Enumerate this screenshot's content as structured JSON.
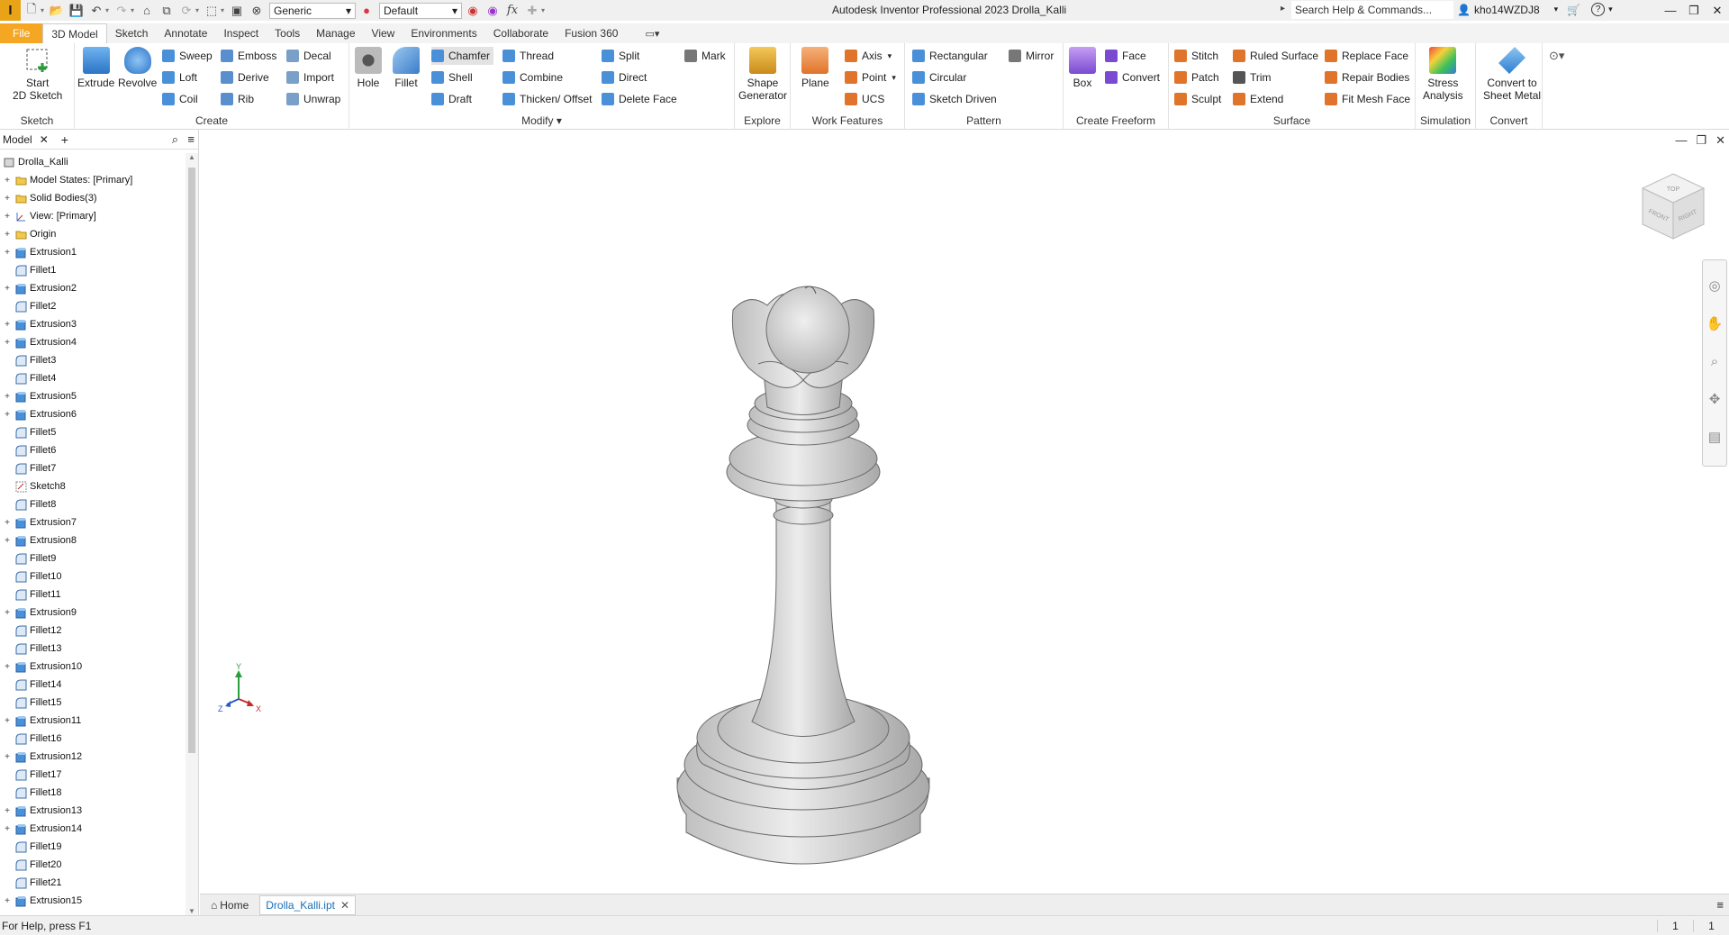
{
  "titlebar": {
    "app_logo": "I",
    "appearance_value": "Generic",
    "material_value": "Default",
    "title": "Autodesk Inventor Professional 2023   Drolla_Kalli",
    "search_placeholder": "Search Help & Commands...",
    "user_name": "kho14WZDJ8"
  },
  "tabs": [
    "File",
    "3D Model",
    "Sketch",
    "Annotate",
    "Inspect",
    "Tools",
    "Manage",
    "View",
    "Environments",
    "Collaborate",
    "Fusion 360"
  ],
  "active_tab": "3D Model",
  "ribbon": {
    "sketch": {
      "label": "Sketch",
      "start_sketch": "Start\n2D Sketch"
    },
    "create": {
      "label": "Create",
      "extrude": "Extrude",
      "revolve": "Revolve",
      "sweep": "Sweep",
      "loft": "Loft",
      "coil": "Coil",
      "emboss": "Emboss",
      "derive": "Derive",
      "rib": "Rib",
      "decal": "Decal",
      "import": "Import",
      "unwrap": "Unwrap"
    },
    "modify": {
      "label": "Modify",
      "hole": "Hole",
      "fillet": "Fillet",
      "chamfer": "Chamfer",
      "shell": "Shell",
      "draft": "Draft",
      "thread": "Thread",
      "combine": "Combine",
      "thicken": "Thicken/ Offset",
      "split": "Split",
      "direct": "Direct",
      "delete_face": "Delete Face",
      "mark": "Mark"
    },
    "explore": {
      "label": "Explore",
      "shape_generator": "Shape\nGenerator"
    },
    "work_features": {
      "label": "Work Features",
      "plane": "Plane",
      "axis": "Axis",
      "point": "Point",
      "ucs": "UCS"
    },
    "pattern": {
      "label": "Pattern",
      "rectangular": "Rectangular",
      "circular": "Circular",
      "sketch_driven": "Sketch Driven",
      "mirror": "Mirror"
    },
    "create_freeform": {
      "label": "Create Freeform",
      "box": "Box",
      "face": "Face",
      "convert": "Convert"
    },
    "surface": {
      "label": "Surface",
      "stitch": "Stitch",
      "patch": "Patch",
      "sculpt": "Sculpt",
      "ruled_surface": "Ruled Surface",
      "trim": "Trim",
      "extend": "Extend",
      "replace_face": "Replace Face",
      "repair_bodies": "Repair Bodies",
      "fit_mesh_face": "Fit Mesh Face"
    },
    "simulation": {
      "label": "Simulation",
      "stress_analysis": "Stress\nAnalysis"
    },
    "convert": {
      "label": "Convert",
      "convert_sheet_metal": "Convert to\nSheet Metal"
    }
  },
  "browser": {
    "tab_label": "Model",
    "root": "Drolla_Kalli",
    "items": [
      {
        "label": "Model States: [Primary]",
        "type": "folder",
        "expandable": true
      },
      {
        "label": "Solid Bodies(3)",
        "type": "folder",
        "expandable": true
      },
      {
        "label": "View: [Primary]",
        "type": "view",
        "expandable": true
      },
      {
        "label": "Origin",
        "type": "folder",
        "expandable": true
      },
      {
        "label": "Extrusion1",
        "type": "extrusion",
        "expandable": true
      },
      {
        "label": "Fillet1",
        "type": "fillet",
        "expandable": false
      },
      {
        "label": "Extrusion2",
        "type": "extrusion",
        "expandable": true
      },
      {
        "label": "Fillet2",
        "type": "fillet",
        "expandable": false
      },
      {
        "label": "Extrusion3",
        "type": "extrusion",
        "expandable": true
      },
      {
        "label": "Extrusion4",
        "type": "extrusion",
        "expandable": true
      },
      {
        "label": "Fillet3",
        "type": "fillet",
        "expandable": false
      },
      {
        "label": "Fillet4",
        "type": "fillet",
        "expandable": false
      },
      {
        "label": "Extrusion5",
        "type": "extrusion",
        "expandable": true
      },
      {
        "label": "Extrusion6",
        "type": "extrusion",
        "expandable": true
      },
      {
        "label": "Fillet5",
        "type": "fillet",
        "expandable": false
      },
      {
        "label": "Fillet6",
        "type": "fillet",
        "expandable": false
      },
      {
        "label": "Fillet7",
        "type": "fillet",
        "expandable": false
      },
      {
        "label": "Sketch8",
        "type": "sketch",
        "expandable": false
      },
      {
        "label": "Fillet8",
        "type": "fillet",
        "expandable": false
      },
      {
        "label": "Extrusion7",
        "type": "extrusion",
        "expandable": true
      },
      {
        "label": "Extrusion8",
        "type": "extrusion",
        "expandable": true
      },
      {
        "label": "Fillet9",
        "type": "fillet",
        "expandable": false
      },
      {
        "label": "Fillet10",
        "type": "fillet",
        "expandable": false
      },
      {
        "label": "Fillet11",
        "type": "fillet",
        "expandable": false
      },
      {
        "label": "Extrusion9",
        "type": "extrusion",
        "expandable": true
      },
      {
        "label": "Fillet12",
        "type": "fillet",
        "expandable": false
      },
      {
        "label": "Fillet13",
        "type": "fillet",
        "expandable": false
      },
      {
        "label": "Extrusion10",
        "type": "extrusion",
        "expandable": true
      },
      {
        "label": "Fillet14",
        "type": "fillet",
        "expandable": false
      },
      {
        "label": "Fillet15",
        "type": "fillet",
        "expandable": false
      },
      {
        "label": "Extrusion11",
        "type": "extrusion",
        "expandable": true
      },
      {
        "label": "Fillet16",
        "type": "fillet",
        "expandable": false
      },
      {
        "label": "Extrusion12",
        "type": "extrusion",
        "expandable": true
      },
      {
        "label": "Fillet17",
        "type": "fillet",
        "expandable": false
      },
      {
        "label": "Fillet18",
        "type": "fillet",
        "expandable": false
      },
      {
        "label": "Extrusion13",
        "type": "extrusion",
        "expandable": true
      },
      {
        "label": "Extrusion14",
        "type": "extrusion",
        "expandable": true
      },
      {
        "label": "Fillet19",
        "type": "fillet",
        "expandable": false
      },
      {
        "label": "Fillet20",
        "type": "fillet",
        "expandable": false
      },
      {
        "label": "Fillet21",
        "type": "fillet",
        "expandable": false
      },
      {
        "label": "Extrusion15",
        "type": "extrusion",
        "expandable": true
      }
    ]
  },
  "viewcube": {
    "top": "TOP",
    "front": "FRONT",
    "right": "RIGHT"
  },
  "triad": {
    "x": "X",
    "y": "Y",
    "z": "Z"
  },
  "doc_tabs": {
    "home": "Home",
    "document": "Drolla_Kalli.ipt"
  },
  "status": {
    "help_text": "For Help, press F1",
    "count_a": "1",
    "count_b": "1"
  },
  "colors": {
    "accent": "#f5a623",
    "active_doc": "#1a6fb5",
    "extrusion_icon": "#4a90d9",
    "model_fill": "#d9d9d9"
  }
}
